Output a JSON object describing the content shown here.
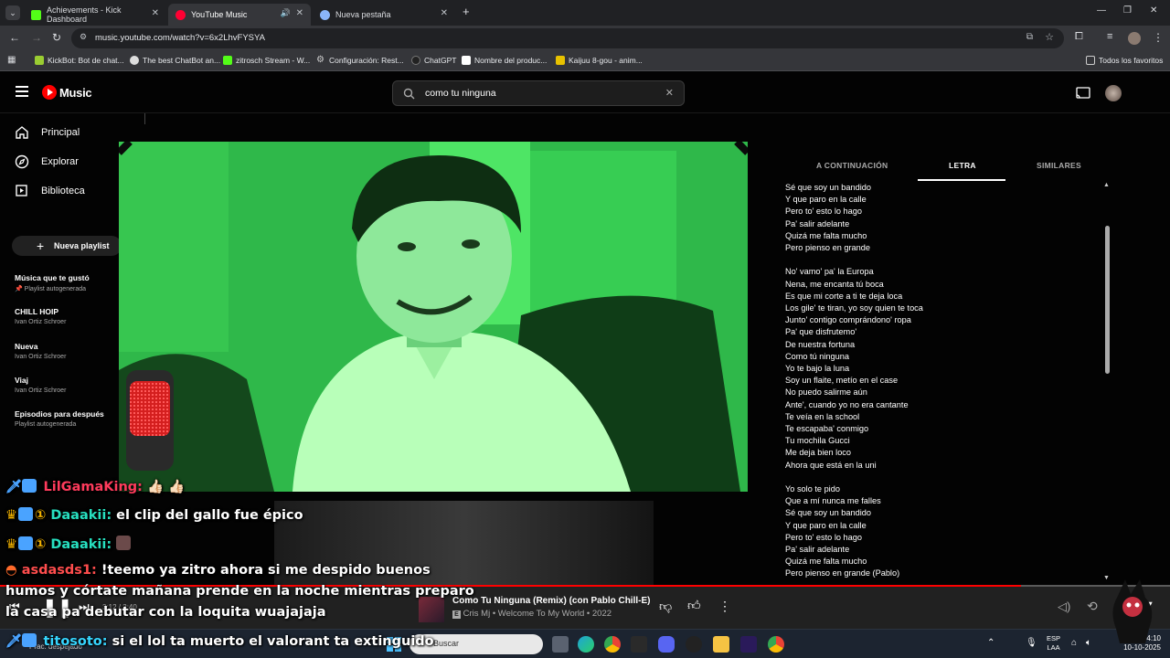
{
  "browser": {
    "tabs": [
      {
        "title": "Achievements - Kick Dashboard"
      },
      {
        "title": "YouTube Music"
      },
      {
        "title": "Nueva pestaña"
      }
    ],
    "url": "music.youtube.com/watch?v=6x2LhvFYSYA",
    "bookmarks": [
      "KickBot: Bot de chat...",
      "The best ChatBot an...",
      "zitrosch Stream - W...",
      "Configuración: Rest...",
      "ChatGPT",
      "Nombre del produc...",
      "Kaijuu 8-gou - anim..."
    ],
    "all_bookmarks": "Todos los favoritos"
  },
  "ytm": {
    "logo": "Music",
    "search_value": "como tu ninguna",
    "nav": [
      "Principal",
      "Explorar",
      "Biblioteca"
    ],
    "new_playlist": "Nueva playlist",
    "playlists": [
      {
        "title": "Música que te gustó",
        "subtitle": "Playlist autogenerada"
      },
      {
        "title": "CHILL HOIP",
        "subtitle": "Ivan Ortiz Schroer"
      },
      {
        "title": "Nueva",
        "subtitle": "Ivan Ortiz Schroer"
      },
      {
        "title": "Viaj",
        "subtitle": "Ivan Ortiz Schroer"
      },
      {
        "title": "Episodios para después",
        "subtitle": "Playlist autogenerada"
      }
    ],
    "tabs": [
      "A CONTINUACIÓN",
      "LETRA",
      "SIMILARES"
    ],
    "lyrics": [
      "Sé que soy un bandido",
      "Y que paro en la calle",
      "Pero to' esto lo hago",
      "Pa' salir adelante",
      "Quizá me falta mucho",
      "Pero pienso en grande",
      "",
      "No' vamo' pa' la Europa",
      "Nena, me encanta tú boca",
      "Es que mi corte a ti te deja loca",
      "Los gile' te tiran, yo soy quien te toca",
      "Junto' contigo comprándono' ropa",
      "Pa' que disfrutemo'",
      "De nuestra fortuna",
      "Como tú ninguna",
      "Yo te bajo la luna",
      "Soy un flaite, metío en el case",
      "No puedo salirme aún",
      "Ante', cuando yo no era cantante",
      "Te veía en la school",
      "Te escapaba' conmigo",
      "Tu mochila Gucci",
      "Me deja bien loco",
      "Ahora que está en la uni",
      "",
      "Yo solo te pido",
      "Que a mí nunca me falles",
      "Sé que soy un bandido",
      "Y que paro en la calle",
      "Pero to' esto lo hago",
      "Pa' salir adelante",
      "Quizá me falta mucho",
      "Pero pienso en grande (Pablo)"
    ],
    "player": {
      "song_title": "Como Tu Ninguna (Remix) (con Pablo Chill-E)",
      "song_meta": "Cris Mj • Welcome To My World • 2022",
      "time": "3:12 / 3:40",
      "progress": 0.873
    }
  },
  "chat": [
    {
      "user": "LilGamaKing:",
      "msg": " 👍🏻 👍🏻",
      "color": "#ff3b5c"
    },
    {
      "user": "Daaakii:",
      "msg": " el clip del gallo fue épico",
      "color": "#27e0c0"
    },
    {
      "user": "Daaakii:",
      "msg": "",
      "color": "#27e0c0"
    },
    {
      "user": "asdasds1:",
      "msg": " !teemo ya zitro ahora si me despido buenos",
      "color": "#ff4d4d"
    },
    {
      "user": "",
      "msg": "humos y córtate mañana prende en la noche mientras preparo",
      "color": "#ffffff"
    },
    {
      "user": "",
      "msg": "la casa pa debutar con la loquita wuajajaja",
      "color": "#ffffff"
    },
    {
      "user": "titosoto:",
      "msg": " si el lol ta muerto el valorant ta extinguido",
      "color": "#36d6ff"
    }
  ],
  "taskbar": {
    "weather": "Prac. despejado",
    "search": "Buscar",
    "lang": "ESP",
    "lang2": "LAA",
    "time": "4:10",
    "date": "10-10-2025"
  }
}
